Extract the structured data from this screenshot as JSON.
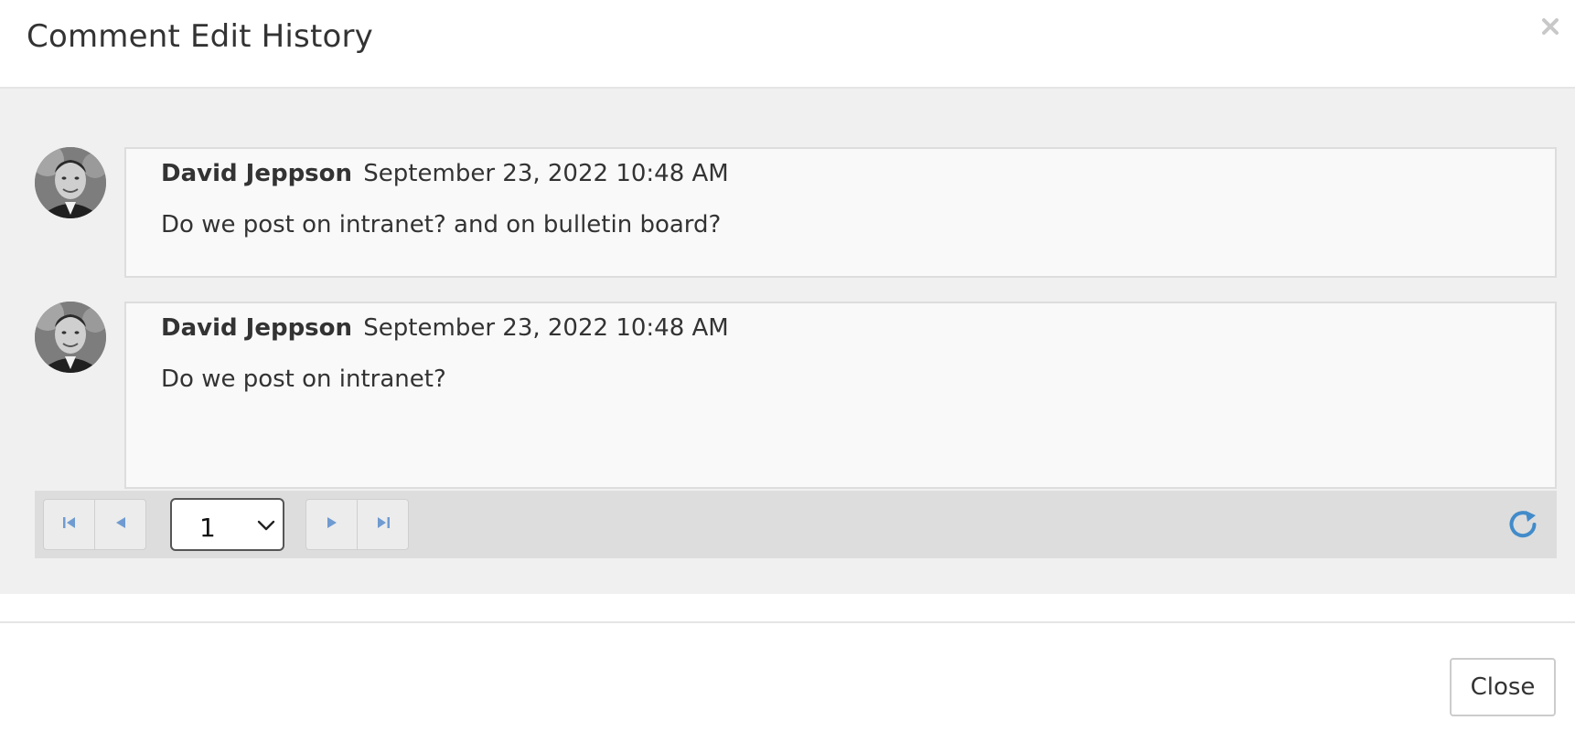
{
  "dialog": {
    "title": "Comment Edit History",
    "close_icon": "close-icon"
  },
  "comments": [
    {
      "author": "David Jeppson",
      "timestamp": "September 23, 2022 10:48 AM",
      "text": "Do we post on intranet? and on bulletin board?",
      "avatar_icon": "user-avatar"
    },
    {
      "author": "David Jeppson",
      "timestamp": "September 23, 2022 10:48 AM",
      "text": "Do we post on intranet?",
      "avatar_icon": "user-avatar"
    }
  ],
  "pager": {
    "current_page": "1",
    "first_icon": "first-page-icon",
    "prev_icon": "previous-page-icon",
    "next_icon": "next-page-icon",
    "last_icon": "last-page-icon",
    "refresh_icon": "refresh-icon"
  },
  "footer": {
    "close_label": "Close"
  },
  "colors": {
    "accent": "#428bca",
    "body_bg": "#f0f0f0",
    "pager_bg": "#dddddd"
  }
}
